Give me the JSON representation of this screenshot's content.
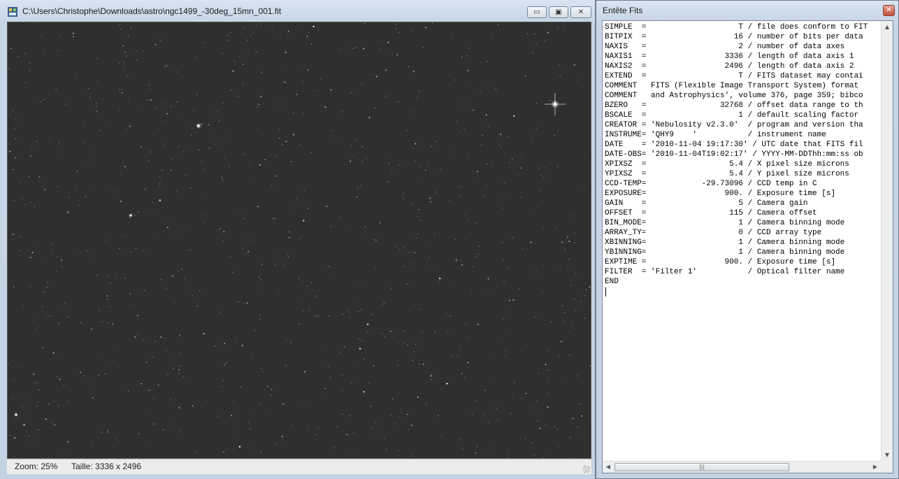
{
  "image_window": {
    "title": "C:\\Users\\Christophe\\Downloads\\astro\\ngc1499_-30deg_15mn_001.fit",
    "buttons": {
      "minimize": "▭",
      "maximize": "▣",
      "close": "✕"
    },
    "status": {
      "zoom": "Zoom: 25%",
      "size": "Taille: 3336 x 2496"
    }
  },
  "fits_window": {
    "title": "Entête Fits",
    "close": "✕",
    "lines": [
      "SIMPLE  =                    T / file does conform to FIT",
      "BITPIX  =                   16 / number of bits per data",
      "NAXIS   =                    2 / number of data axes",
      "NAXIS1  =                 3336 / length of data axis 1",
      "NAXIS2  =                 2496 / length of data axis 2",
      "EXTEND  =                    T / FITS dataset may contai",
      "COMMENT   FITS (Flexible Image Transport System) format",
      "COMMENT   and Astrophysics', volume 376, page 359; bibco",
      "BZERO   =                32768 / offset data range to th",
      "BSCALE  =                    1 / default scaling factor",
      "CREATOR = 'Nebulosity v2.3.0'  / program and version tha",
      "INSTRUME= 'QHY9    '           / instrument name",
      "DATE    = '2010-11-04 19:17:30' / UTC date that FITS fil",
      "DATE-OBS= '2010-11-04T19:02:17' / YYYY-MM-DDThh:mm:ss ob",
      "XPIXSZ  =                  5.4 / X pixel size microns",
      "YPIXSZ  =                  5.4 / Y pixel size microns",
      "CCD-TEMP=            -29.73096 / CCD temp in C",
      "EXPOSURE=                 900. / Exposure time [s]",
      "GAIN    =                    5 / Camera gain",
      "OFFSET  =                  115 / Camera offset",
      "BIN_MODE=                    1 / Camera binning mode",
      "ARRAY_TY=                    0 / CCD array type",
      "XBINNING=                    1 / Camera binning mode",
      "YBINNING=                    1 / Camera binning mode",
      "EXPTIME =                 900. / Exposure time [s]",
      "FILTER  = 'Filter 1'           / Optical filter name",
      "END"
    ]
  }
}
